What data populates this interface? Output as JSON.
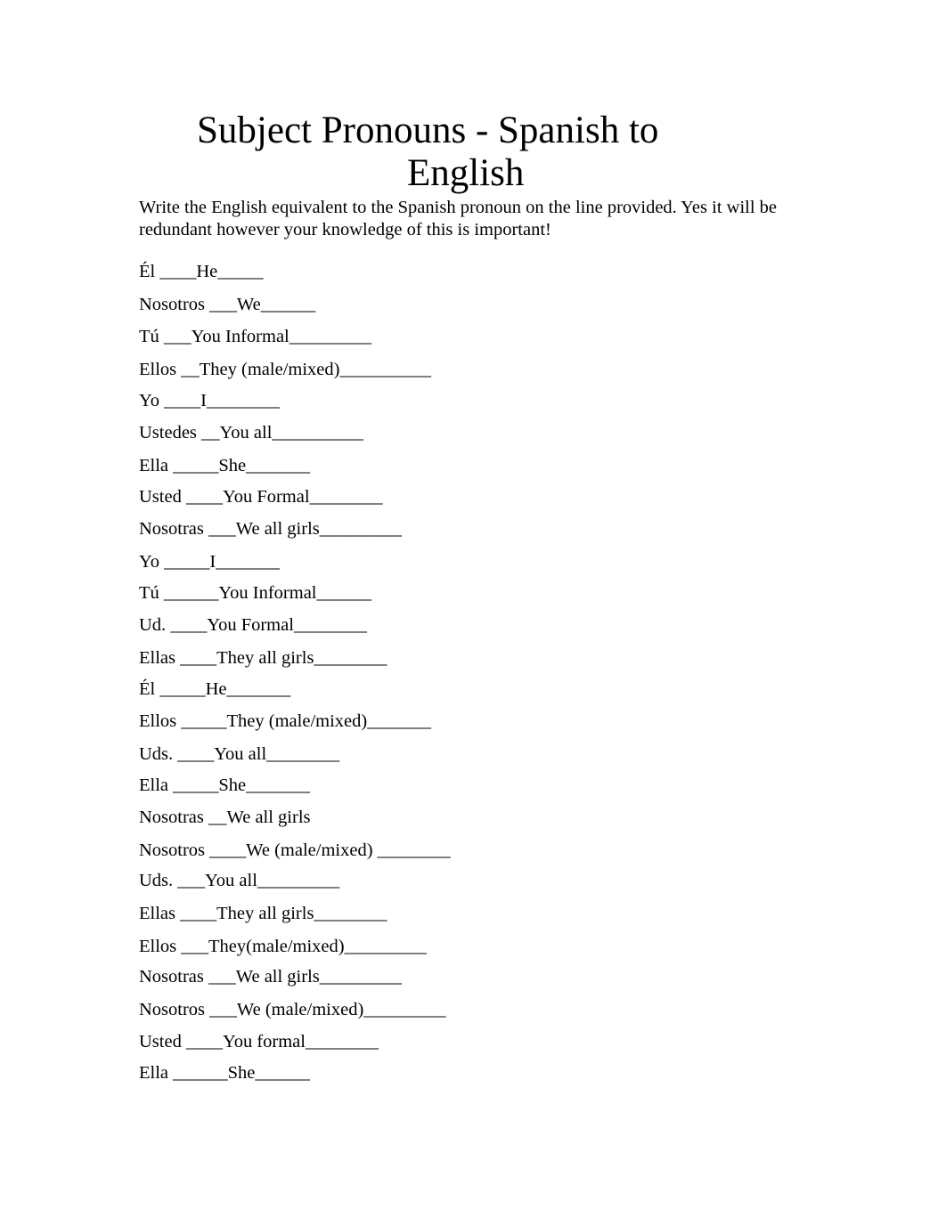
{
  "document": {
    "title_line1": "Subject Pronouns - Spanish to",
    "title_line2": "English",
    "instructions": "Write the English equivalent to the Spanish pronoun on the line provided.  Yes it will be redundant however your knowledge of this is important!"
  },
  "highlight_color": "#ffff00",
  "rows": [
    {
      "spanish": "Él",
      "pre": "____",
      "answer": "He",
      "post": "_____"
    },
    {
      "spanish": "Nosotros",
      "pre": "___",
      "answer": "We",
      "post": "______",
      "highlighted": true
    },
    {
      "spanish": "Tú",
      "pre": "___",
      "answer": "You Informal",
      "post": "_________"
    },
    {
      "spanish": "Ellos",
      "pre": "__",
      "answer": "They (male/mixed)",
      "post": "__________"
    },
    {
      "spanish": "Yo",
      "pre": "____",
      "answer": "I",
      "post": "________"
    },
    {
      "spanish": "Ustedes",
      "pre": "__",
      "answer": "You all",
      "post": "__________"
    },
    {
      "spanish": "Ella",
      "pre": "_____",
      "answer": "She",
      "post": "_______"
    },
    {
      "spanish": "Usted",
      "pre": "____",
      "answer": "You Formal",
      "post": "________"
    },
    {
      "spanish": "Nosotras",
      "pre": "___",
      "answer": "We all girls",
      "post": "_________"
    },
    {
      "spanish": "Yo",
      "pre": "_____",
      "answer": "I",
      "post": "_______"
    },
    {
      "spanish": "Tú",
      "pre": "______",
      "answer": "You Informal",
      "post": "______"
    },
    {
      "spanish": "Ud.",
      "pre": "____",
      "answer": "You Formal",
      "post": "________"
    },
    {
      "spanish": "Ellas",
      "pre": "____",
      "answer": "They all girls",
      "post": "________"
    },
    {
      "spanish": "Él",
      "pre": "_____",
      "answer": "He",
      "post": "_______"
    },
    {
      "spanish": "Ellos",
      "pre": "_____",
      "answer": "They (male/mixed)",
      "post": "_______"
    },
    {
      "spanish": "Uds.",
      "pre": "____",
      "answer": "You all",
      "post": "________"
    },
    {
      "spanish": "Ella",
      "pre": "_____",
      "answer": "She",
      "post": "_______"
    },
    {
      "spanish": "Nosotras",
      "pre": "__",
      "answer": "We all girls",
      "post": "",
      "highlighted": true
    },
    {
      "spanish": "Nosotros",
      "pre": "____",
      "answer": "We (male/mixed)",
      "post": " ________"
    },
    {
      "spanish": "Uds.",
      "pre": "___",
      "answer": "You all",
      "post": "_________"
    },
    {
      "spanish": "Ellas",
      "pre": "____",
      "answer": "They all girls",
      "post": "________"
    },
    {
      "spanish": "Ellos",
      "pre": "___",
      "answer": "They(male/mixed)",
      "post": "_________"
    },
    {
      "spanish": "Nosotras",
      "pre": "___",
      "answer": "We all girls",
      "post": "_________"
    },
    {
      "spanish": "Nosotros",
      "pre": "___",
      "answer": "We (male/mixed)",
      "post": "_________"
    },
    {
      "spanish": "Usted",
      "pre": "____",
      "answer": "You formal",
      "post": "________"
    },
    {
      "spanish": "Ella",
      "pre": "______",
      "answer": "She",
      "post": "______"
    }
  ]
}
